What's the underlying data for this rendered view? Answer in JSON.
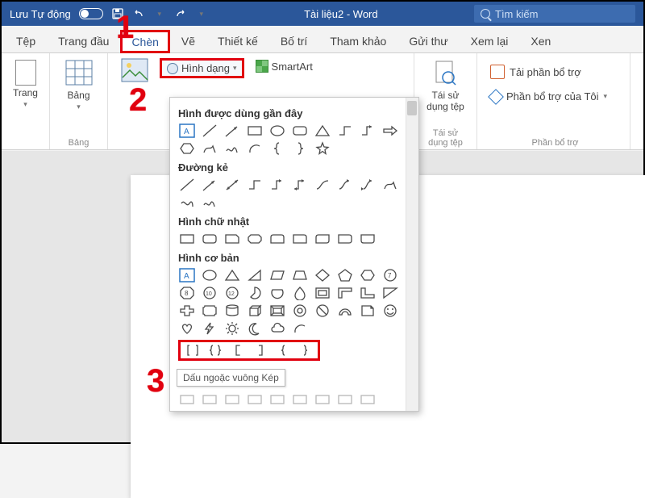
{
  "titlebar": {
    "autosave_label": "Lưu Tự động",
    "doc_title": "Tài liệu2  -  Word",
    "search_placeholder": "Tìm kiếm"
  },
  "tabs": {
    "file": "Tệp",
    "home": "Trang đầu",
    "insert": "Chèn",
    "draw": "Vẽ",
    "design": "Thiết kế",
    "layout": "Bố trí",
    "references": "Tham khảo",
    "mailings": "Gửi thư",
    "review": "Xem lại",
    "view": "Xen"
  },
  "ribbon": {
    "pages": {
      "label": "Trang",
      "group_label": ""
    },
    "tables": {
      "label": "Bảng",
      "group_label": "Bảng"
    },
    "illustrations": {
      "shapes_label": "Hình dạng",
      "smartart_label": "SmartArt"
    },
    "reuse": {
      "label": "Tái sử\ndụng tệp",
      "group_label": "Tái sử dụng tệp"
    },
    "addins": {
      "get": "Tải phần bổ trợ",
      "my": "Phần bổ trợ của Tôi",
      "group_label": "Phần bổ trợ"
    }
  },
  "dropdown": {
    "recent": "Hình được dùng gần đây",
    "lines": "Đường kẻ",
    "rects": "Hình chữ nhật",
    "basic": "Hình cơ bản",
    "tooltip": "Dấu ngoặc vuông Kép"
  },
  "annotations": {
    "n1": "1",
    "n2": "2",
    "n3": "3"
  }
}
